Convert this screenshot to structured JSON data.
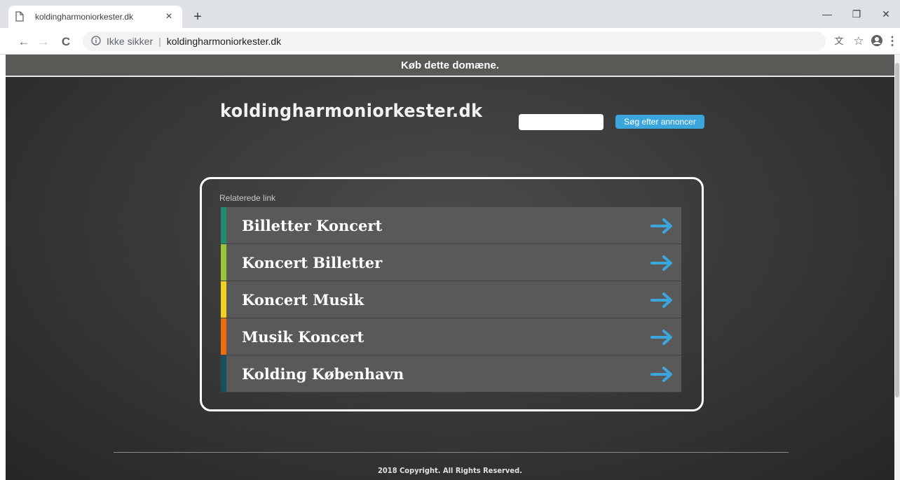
{
  "browser": {
    "tab_title": "koldingharmoniorkester.dk",
    "tab_close": "×",
    "new_tab": "+",
    "minimize": "—",
    "restore": "❐",
    "close": "✕",
    "back": "←",
    "forward": "→",
    "reload": "C",
    "security_label": "Ikke sikker",
    "separator": "|",
    "url": "koldingharmoniorkester.dk",
    "translate": "文",
    "bookmark": "☆",
    "menu": "⋮"
  },
  "page": {
    "buy_banner": "Køb dette domæne.",
    "site_title": "koldingharmoniorkester.dk",
    "search": {
      "placeholder": "",
      "value": "",
      "button_label": "Søg efter annoncer"
    },
    "related": {
      "heading": "Relaterede link",
      "items": [
        {
          "label": "Billetter Koncert",
          "stripe_color": "#1e8c6e"
        },
        {
          "label": "Koncert Billetter",
          "stripe_color": "#9cc43a"
        },
        {
          "label": "Koncert Musik",
          "stripe_color": "#f2d21a"
        },
        {
          "label": "Musik Koncert",
          "stripe_color": "#ee6c0c"
        },
        {
          "label": "Kolding København",
          "stripe_color": "#16505e"
        }
      ]
    },
    "copyright": "2018 Copyright. All Rights Reserved."
  },
  "colors": {
    "accent_button": "#3aa6dc",
    "arrow": "#3aa6dc",
    "banner": "#5b5955",
    "link_row": "#595959"
  }
}
